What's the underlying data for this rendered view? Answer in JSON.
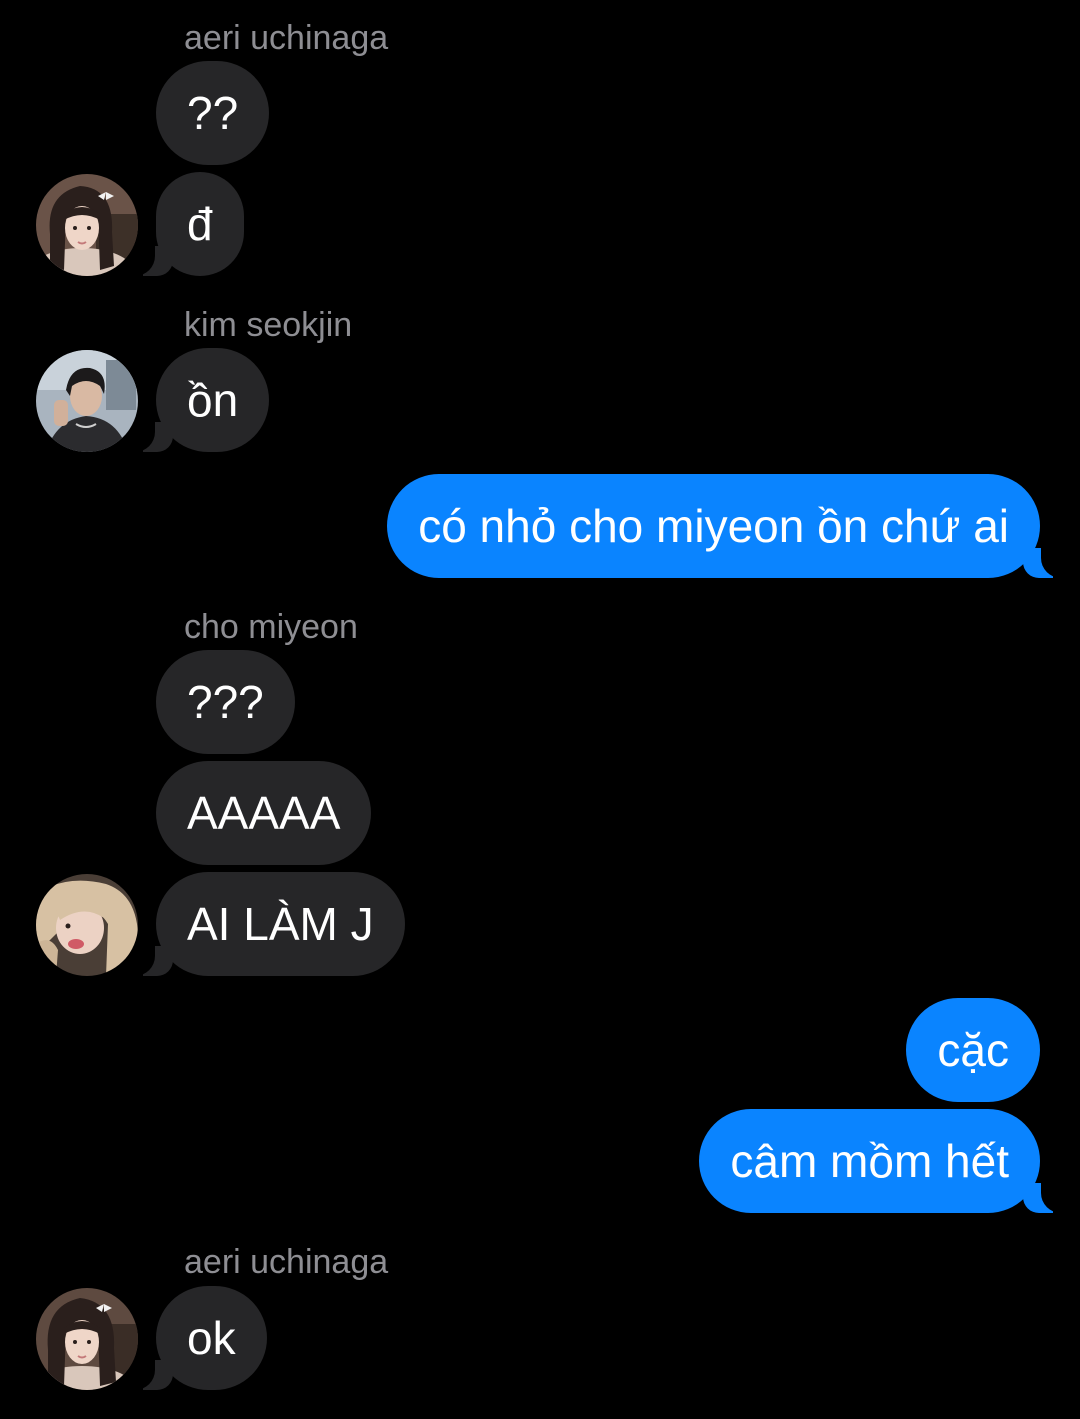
{
  "messages": {
    "g1_sender": "aeri uchinaga",
    "g1_m1": "??",
    "g1_m2": "đ",
    "g2_sender": "kim seokjin",
    "g2_m1": "ồn",
    "me1": "có nhỏ cho miyeon ồn chứ ai",
    "g3_sender": "cho miyeon",
    "g3_m1": "???",
    "g3_m2": "AAAAA",
    "g3_m3": "AI LÀM J",
    "me2": "cặc",
    "me3": "câm mồm hết",
    "g4_sender": "aeri uchinaga",
    "g4_m1": "ok"
  },
  "avatars": {
    "aeri": "avatar-aeri-uchinaga",
    "seokjin": "avatar-kim-seokjin",
    "miyeon": "avatar-cho-miyeon"
  },
  "colors": {
    "background": "#000000",
    "incoming_bubble": "#262628",
    "outgoing_bubble": "#0a84ff",
    "sender_name": "#8e8e93",
    "text": "#ffffff"
  }
}
